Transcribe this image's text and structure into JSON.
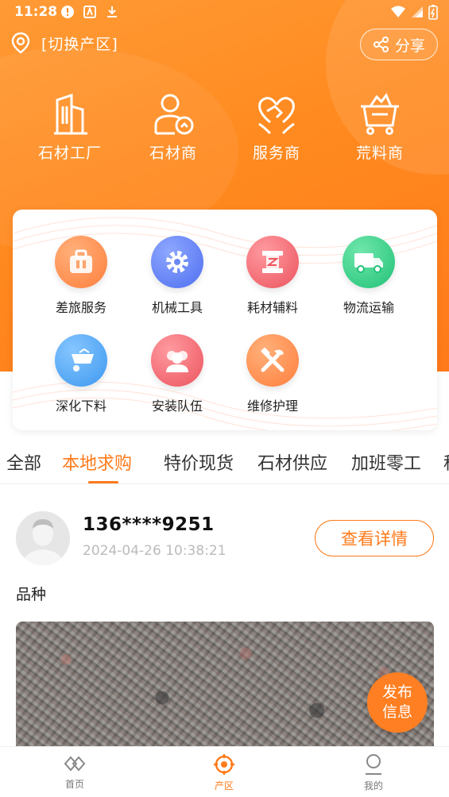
{
  "status_bar": {
    "time": "11:28"
  },
  "location": {
    "label": "[切换产区]"
  },
  "share": {
    "label": "分享"
  },
  "categories": [
    {
      "label": "石材工厂",
      "icon": "building-icon"
    },
    {
      "label": "石材商",
      "icon": "merchant-icon"
    },
    {
      "label": "服务商",
      "icon": "handshake-heart-icon"
    },
    {
      "label": "荒料商",
      "icon": "cart-icon"
    }
  ],
  "services": [
    {
      "label": "差旅服务",
      "icon": "suitcase-icon",
      "color": "#ff8c4a"
    },
    {
      "label": "机械工具",
      "icon": "gear-icon",
      "color": "#5b7df5"
    },
    {
      "label": "耗材辅料",
      "icon": "spool-icon",
      "color": "#f0616a"
    },
    {
      "label": "物流运输",
      "icon": "truck-icon",
      "color": "#2fcf86"
    },
    {
      "label": "深化下料",
      "icon": "wheelbarrow-icon",
      "color": "#3fa1f3"
    },
    {
      "label": "安装队伍",
      "icon": "team-icon",
      "color": "#f0616a"
    },
    {
      "label": "维修护理",
      "icon": "wrench-hammer-icon",
      "color": "#ff8c4a"
    }
  ],
  "tabs": [
    {
      "label": "全部"
    },
    {
      "label": "本地求购",
      "active": true
    },
    {
      "label": "特价现货"
    },
    {
      "label": "石材供应"
    },
    {
      "label": "加班零工"
    },
    {
      "label": "科"
    }
  ],
  "post": {
    "name": "136****9251",
    "time": "2024-04-26 10:38:21",
    "detail_label": "查看详情",
    "variety_label": "品种"
  },
  "fab": {
    "line1": "发布",
    "line2": "信息"
  },
  "nav": [
    {
      "label": "首页",
      "icon": "home-icon",
      "active": false
    },
    {
      "label": "产区",
      "icon": "target-icon",
      "active": true
    },
    {
      "label": "我的",
      "icon": "user-icon",
      "active": false
    }
  ],
  "colors": {
    "accent": "#ff7a1a"
  }
}
